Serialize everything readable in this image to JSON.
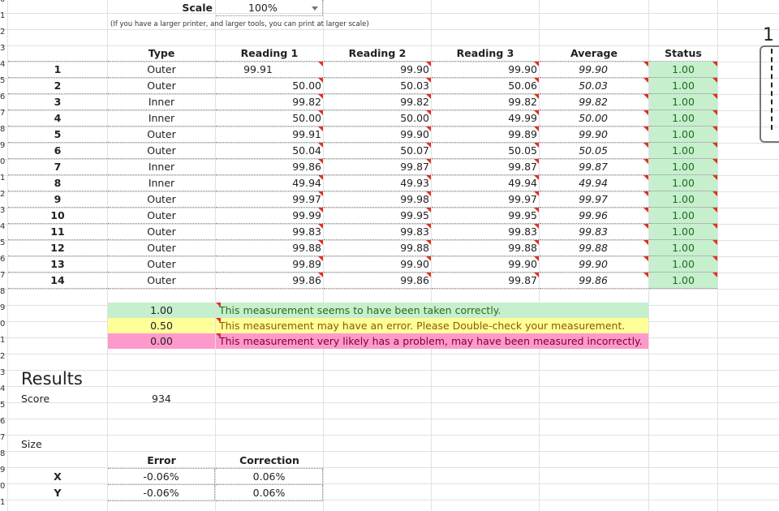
{
  "row_numbers": [
    "0",
    "1",
    "2",
    "3",
    "4",
    "5",
    "6",
    "7",
    "8",
    "9",
    "0",
    "1",
    "2",
    "3",
    "4",
    "5",
    "6",
    "7",
    "8",
    "9",
    "0",
    "1",
    "2",
    "3",
    "4",
    "5",
    "6",
    "7",
    "8",
    "9",
    "0",
    "1"
  ],
  "scale": {
    "label": "Scale",
    "value": "100%",
    "note": "(If you have a larger printer, and larger tools, you can print at larger scale)"
  },
  "headers": {
    "type": "Type",
    "reading1": "Reading 1",
    "reading2": "Reading 2",
    "reading3": "Reading 3",
    "average": "Average",
    "status": "Status"
  },
  "rows": [
    {
      "n": "1",
      "type": "Outer",
      "r1": "99.91",
      "r2": "99.90",
      "r3": "99.90",
      "avg": "99.90",
      "status": "1.00"
    },
    {
      "n": "2",
      "type": "Outer",
      "r1": "50.00",
      "r2": "50.03",
      "r3": "50.06",
      "avg": "50.03",
      "status": "1.00"
    },
    {
      "n": "3",
      "type": "Inner",
      "r1": "99.82",
      "r2": "99.82",
      "r3": "99.82",
      "avg": "99.82",
      "status": "1.00"
    },
    {
      "n": "4",
      "type": "Inner",
      "r1": "50.00",
      "r2": "50.00",
      "r3": "49.99",
      "avg": "50.00",
      "status": "1.00"
    },
    {
      "n": "5",
      "type": "Outer",
      "r1": "99.91",
      "r2": "99.90",
      "r3": "99.89",
      "avg": "99.90",
      "status": "1.00"
    },
    {
      "n": "6",
      "type": "Outer",
      "r1": "50.04",
      "r2": "50.07",
      "r3": "50.05",
      "avg": "50.05",
      "status": "1.00"
    },
    {
      "n": "7",
      "type": "Inner",
      "r1": "99.86",
      "r2": "99.87",
      "r3": "99.87",
      "avg": "99.87",
      "status": "1.00"
    },
    {
      "n": "8",
      "type": "Inner",
      "r1": "49.94",
      "r2": "49.93",
      "r3": "49.94",
      "avg": "49.94",
      "status": "1.00"
    },
    {
      "n": "9",
      "type": "Outer",
      "r1": "99.97",
      "r2": "99.98",
      "r3": "99.97",
      "avg": "99.97",
      "status": "1.00"
    },
    {
      "n": "10",
      "type": "Outer",
      "r1": "99.99",
      "r2": "99.95",
      "r3": "99.95",
      "avg": "99.96",
      "status": "1.00"
    },
    {
      "n": "11",
      "type": "Outer",
      "r1": "99.83",
      "r2": "99.83",
      "r3": "99.83",
      "avg": "99.83",
      "status": "1.00"
    },
    {
      "n": "12",
      "type": "Outer",
      "r1": "99.88",
      "r2": "99.88",
      "r3": "99.88",
      "avg": "99.88",
      "status": "1.00"
    },
    {
      "n": "13",
      "type": "Outer",
      "r1": "99.89",
      "r2": "99.90",
      "r3": "99.90",
      "avg": "99.90",
      "status": "1.00"
    },
    {
      "n": "14",
      "type": "Outer",
      "r1": "99.86",
      "r2": "99.86",
      "r3": "99.87",
      "avg": "99.86",
      "status": "1.00"
    }
  ],
  "legend": [
    {
      "value": "1.00",
      "text": "This measurement seems to have been taken correctly.",
      "color": "#c6efce"
    },
    {
      "value": "0.50",
      "text": "This measurement may have an error. Please Double-check your measurement.",
      "color": "#ffff99"
    },
    {
      "value": "0.00",
      "text": "This measurement very likely has a problem, may have been measured incorrectly.",
      "color": "#ff99cc"
    }
  ],
  "results": {
    "title": "Results",
    "score_label": "Score",
    "score": "934",
    "size_label": "Size"
  },
  "size_table": {
    "error_header": "Error",
    "correction_header": "Correction",
    "rows": [
      {
        "axis": "X",
        "error": "-0.06%",
        "correction": "0.06%"
      },
      {
        "axis": "Y",
        "error": "-0.06%",
        "correction": "0.06%"
      }
    ]
  },
  "side_fragment": "1"
}
